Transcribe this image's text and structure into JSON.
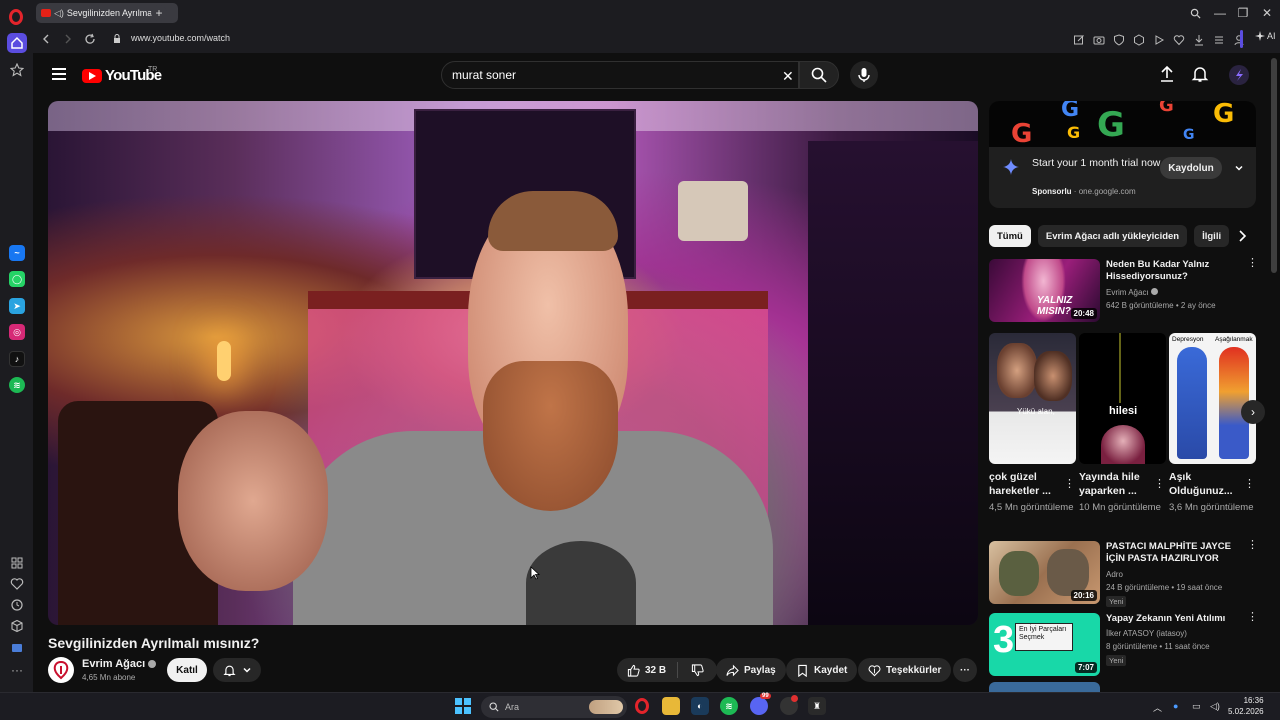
{
  "browser": {
    "tab_title": "Sevgilinizden Ayrılmalı",
    "new_tab": "+",
    "url": "www.youtube.com/watch",
    "ai_label": "AI"
  },
  "youtube": {
    "logo_text": "YouTube",
    "region": "TR",
    "search": {
      "value": "murat soner",
      "clear": "✕"
    },
    "video": {
      "title": "Sevgilinizden Ayrılmalı mısınız?"
    },
    "channel": {
      "name": "Evrim Ağacı",
      "subscribers": "4,65 Mn abone",
      "join_label": "Katıl"
    },
    "actions": {
      "likes": "32 B",
      "share": "Paylaş",
      "save": "Kaydet",
      "thanks": "Teşekkürler",
      "more": "···"
    },
    "ad": {
      "title": "Start your 1 month trial now",
      "sponsored": "Sponsorlu",
      "domain": "one.google.com",
      "button": "Kaydolun",
      "separator": "·"
    },
    "chips": [
      "Tümü",
      "Evrim Ağacı adlı yükleyiciden",
      "İlgili"
    ],
    "recommendations": [
      {
        "title": "Neden Bu Kadar Yalnız Hissediyorsunuz?",
        "channel": "Evrim Ağacı",
        "meta": "642 B görüntüleme • 2 ay önce",
        "duration": "20:48",
        "thumb_text": "YALNIZ MISIN?",
        "new": ""
      },
      {
        "title": "PASTACI MALPHİTE JAYCE İÇİN PASTA HAZIRLIYOR",
        "channel": "Adro",
        "meta": "24 B görüntüleme • 19 saat önce",
        "duration": "20:16",
        "thumb_text": "",
        "new": "Yeni"
      },
      {
        "title": "Yapay Zekanın Yeni Atılımı",
        "channel": "İlker ATASOY (iatasoy)",
        "meta": "8 görüntüleme • 11 saat önce",
        "duration": "7:07",
        "thumb_text": "En İyi Parçaları Seçmek",
        "new": "Yeni"
      }
    ],
    "shorts": [
      {
        "title": "çok güzel hareketler ...",
        "views": "4,5 Mn görüntüleme",
        "thumb_text": "Yükü alan,"
      },
      {
        "title": "Yayında hile yaparken ...",
        "views": "10 Mn görüntüleme",
        "thumb_text": "hilesi"
      },
      {
        "title": "Aşık Olduğunuz...",
        "views": "3,6 Mn görüntüleme",
        "thumb_text_left": "Depresyon",
        "thumb_text_right": "Aşağılanmak"
      }
    ]
  },
  "taskbar": {
    "search_placeholder": "Ara",
    "time": "16:36",
    "date": "5.02.2026",
    "discord_badge": "99"
  },
  "colors": {
    "youtube_red": "#ff0000",
    "background": "#0f0f0f",
    "opera_accent": "#5b4de0"
  }
}
